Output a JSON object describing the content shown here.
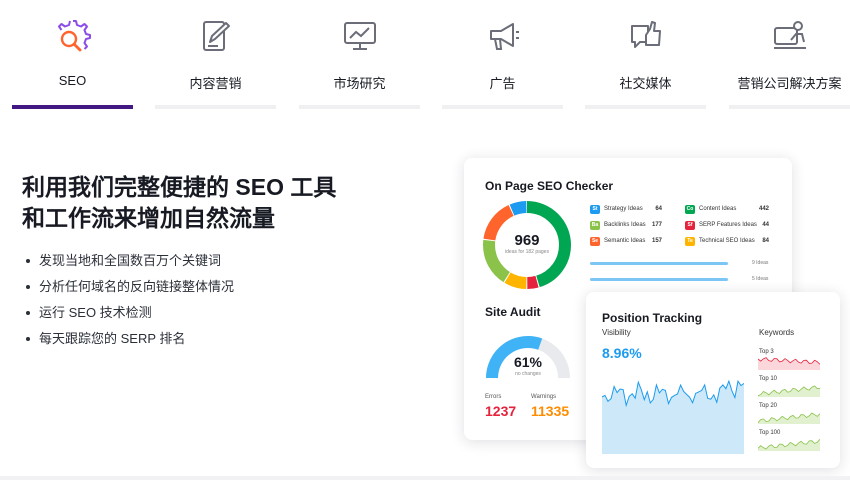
{
  "tabs": [
    {
      "label": "SEO",
      "icon": "seo-gear-magnifier-icon",
      "active": true
    },
    {
      "label": "内容营销",
      "icon": "pencil-edit-icon",
      "active": false
    },
    {
      "label": "市场研究",
      "icon": "monitor-chart-icon",
      "active": false
    },
    {
      "label": "广告",
      "icon": "megaphone-icon",
      "active": false
    },
    {
      "label": "社交媒体",
      "icon": "thumbs-up-chat-icon",
      "active": false
    },
    {
      "label": "营销公司解决方案",
      "icon": "presenter-board-icon",
      "active": false
    }
  ],
  "hero": {
    "headline": "利用我们完整便捷的 SEO 工具和工作流来增加自然流量",
    "bullets": [
      "发现当地和全国数百万个关键词",
      "分析任何域名的反向链接整体情况",
      "运行 SEO 技术检测",
      "每天跟踪您的 SERP 排名"
    ]
  },
  "onpage": {
    "title": "On Page SEO Checker",
    "total": "969",
    "total_sub": "ideas for 182 pages",
    "ideas": [
      {
        "badge": "St",
        "name": "Strategy Ideas",
        "count": "64",
        "color": "#1d9bf0"
      },
      {
        "badge": "Ba",
        "name": "Backlinks Ideas",
        "count": "177",
        "color": "#8bc34a"
      },
      {
        "badge": "Se",
        "name": "Semantic Ideas",
        "count": "157",
        "color": "#ff642d"
      },
      {
        "badge": "Co",
        "name": "Content Ideas",
        "count": "442",
        "color": "#00a651"
      },
      {
        "badge": "Sf",
        "name": "SERP Features Ideas",
        "count": "44",
        "color": "#e5233c"
      },
      {
        "badge": "Te",
        "name": "Technical SEO Ideas",
        "count": "84",
        "color": "#ffb400"
      }
    ],
    "progress": [
      {
        "label": "9 Ideas",
        "fraction": 0.93
      },
      {
        "label": "5 Ideas",
        "fraction": 0.93
      }
    ]
  },
  "audit": {
    "title": "Site Audit",
    "percent": "61%",
    "percent_value": 0.61,
    "percent_sub": "no changes",
    "errors_label": "Errors",
    "errors_value": "1237",
    "warnings_label": "Warnings",
    "warnings_value": "11335",
    "errors_color": "#e5233c",
    "warnings_color": "#ff8c00"
  },
  "tracking": {
    "title": "Position Tracking",
    "visibility_label": "Visibility",
    "visibility_value": "8.96%",
    "keywords_label": "Keywords",
    "keyword_groups": [
      {
        "label": "Top 3",
        "color": "#e5233c"
      },
      {
        "label": "Top 10",
        "color": "#8bc34a"
      },
      {
        "label": "Top 20",
        "color": "#8bc34a"
      },
      {
        "label": "Top 100",
        "color": "#8bc34a"
      }
    ]
  },
  "colors": {
    "accent": "#421983",
    "seo_icon_orange": "#ff642d",
    "seo_icon_purple": "#8c4ce8",
    "visibility_blue": "#1d9bf0"
  }
}
